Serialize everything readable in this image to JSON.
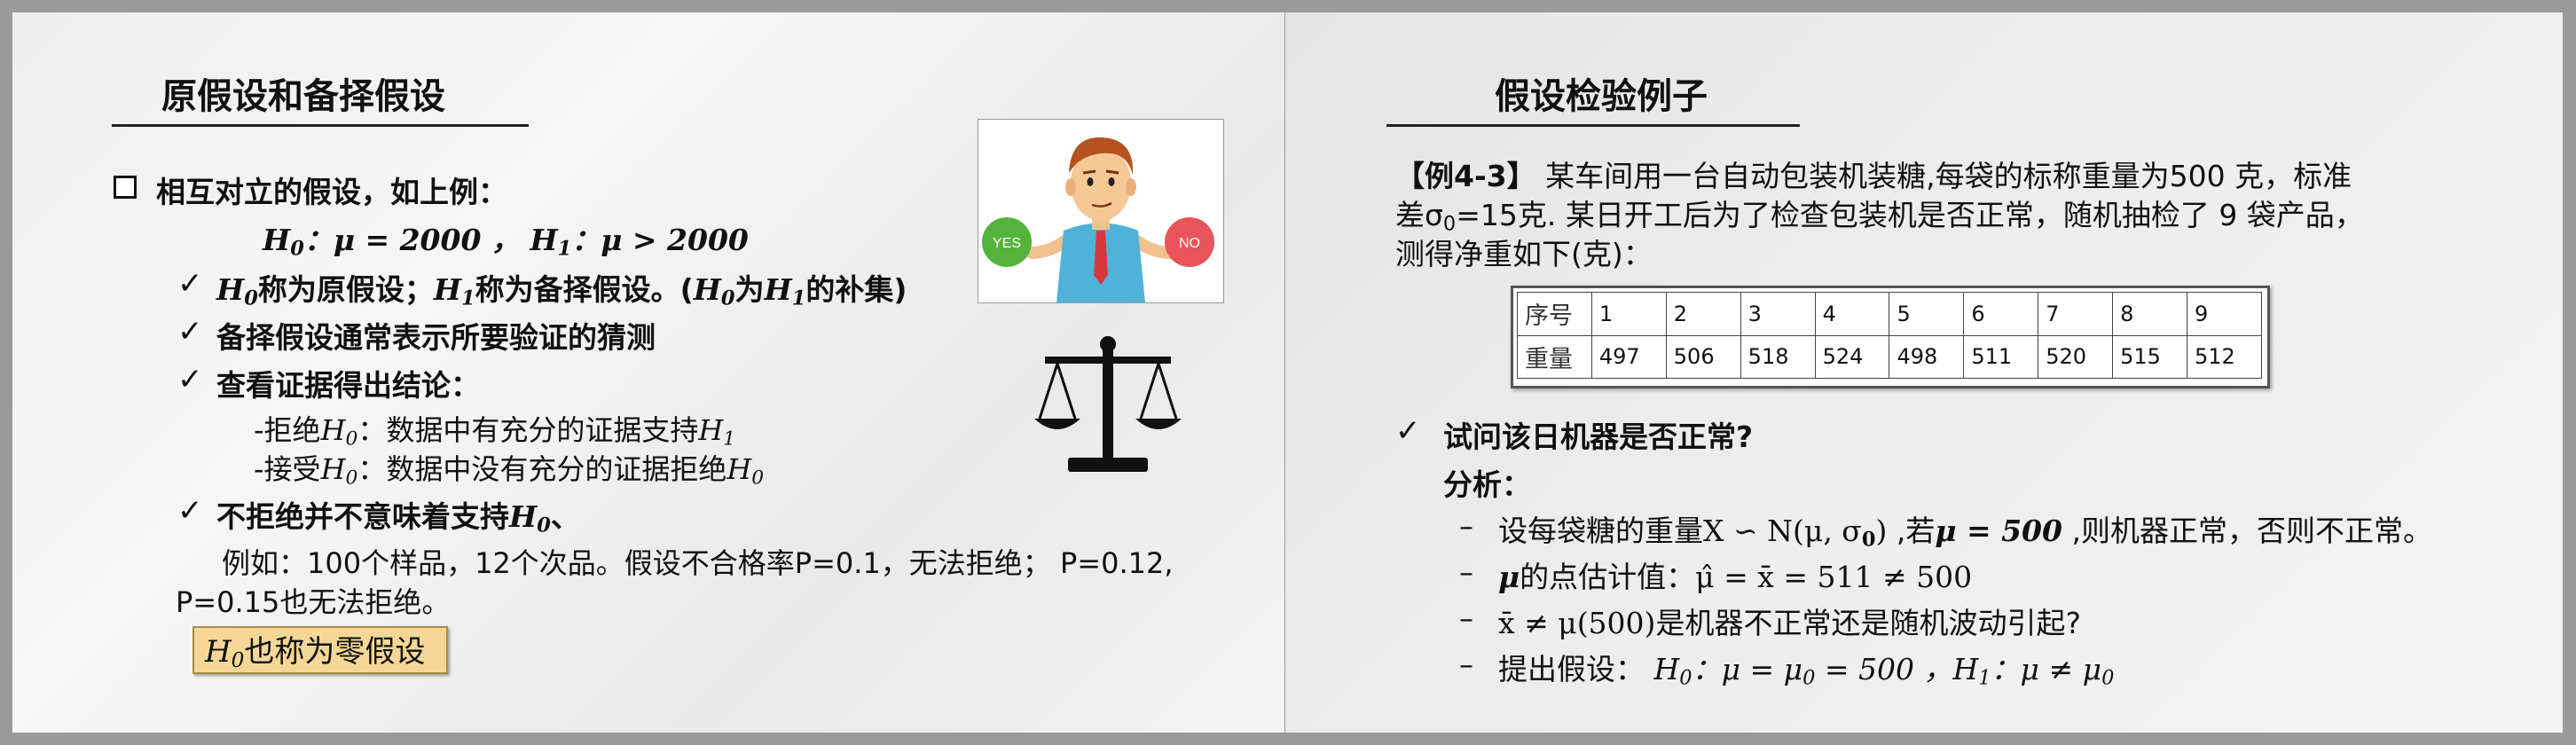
{
  "left": {
    "title": "原假设和备择假设",
    "heading": "相互对立的假设，如上例：",
    "formula": {
      "h0": "H",
      "h0_sub": "0",
      "h0_rel": "：μ = 2000 ，",
      "h1": "H",
      "h1_sub": "1",
      "h1_rel": "：μ > 2000"
    },
    "check_mark": "✓",
    "bullet1": {
      "h0": "H",
      "h0_sub": "0",
      "mid": "称为原假设；",
      "h1": "H",
      "h1_sub": "1",
      "mid2": "称为备择假设。(",
      "h0b": "H",
      "h0b_sub": "0",
      "mid3": "为",
      "h1b": "H",
      "h1b_sub": "1",
      "end": "的补集)"
    },
    "bullet2": "备择假设通常表示所要验证的猜测",
    "bullet3": "查看证据得出结论：",
    "reject": {
      "prefix": "-拒绝",
      "h": "H",
      "h_sub": "0",
      "mid": "：数据中有充分的证据支持",
      "h2": "H",
      "h2_sub": "1"
    },
    "accept": {
      "prefix": "-接受",
      "h": "H",
      "h_sub": "0",
      "mid": "：数据中没有充分的证据拒绝",
      "h2": "H",
      "h2_sub": "0"
    },
    "bullet4": {
      "text": "不拒绝并不意味着支持",
      "h": "H",
      "h_sub": "0",
      "end": "、"
    },
    "example_line1": "例如：100个样品，12个次品。假设不合格率P=0.1，无法拒绝； P=0.12,",
    "example_line2": "P=0.15也无法拒绝。",
    "note": {
      "h": "H",
      "h_sub": "0",
      "text": "也称为零假设"
    },
    "image_labels": {
      "yes": "YES",
      "no": "NO"
    }
  },
  "right": {
    "title": "假设检验例子",
    "example_tag": "【例4-3】",
    "para_line1": "某车间用一台自动包装机装糖,每袋的标称重量为500 克，标准",
    "para_line2_pre": "差σ",
    "para_line2_sub": "0",
    "para_line2_post": "=15克. 某日开工后为了检查包装机是否正常，随机抽检了 9  袋产品，",
    "para_line3": "测得净重如下(克)：",
    "table": {
      "row1_header": "序号",
      "row2_header": "重量",
      "indices": [
        "1",
        "2",
        "3",
        "4",
        "5",
        "6",
        "7",
        "8",
        "9"
      ],
      "weights": [
        "497",
        "506",
        "518",
        "524",
        "498",
        "511",
        "520",
        "515",
        "512"
      ]
    },
    "check_mark": "✓",
    "question": "试问该日机器是否正常?",
    "analysis": "分析：",
    "dash": "–",
    "item1_pre": "设每袋糖的重量",
    "item1_math": "X ∽ N(μ, σ",
    "item1_math_sub": "0",
    "item1_math_end": ")",
    "item1_mid": " ,若",
    "item1_math2": "μ = 500",
    "item1_post": " ,则机器正常，否则不正常。",
    "item2_math": "μ",
    "item2_text": "的点估计值：",
    "item2_math2": "μ̂ = x̄ = 511 ≠ 500",
    "item3_math": "x̄ ≠ μ(500)",
    "item3_text": "是机器不正常还是随机波动引起?",
    "item4_text": "提出假设：",
    "item4_math": "H",
    "item4_sub": "0",
    "item4_rel": "：μ = μ",
    "item4_rel_sub": "0",
    "item4_rel_end": " = 500 ，",
    "item4_math2": "H",
    "item4_sub2": "1",
    "item4_rel2": "：μ ≠ μ",
    "item4_rel2_sub": "0"
  }
}
